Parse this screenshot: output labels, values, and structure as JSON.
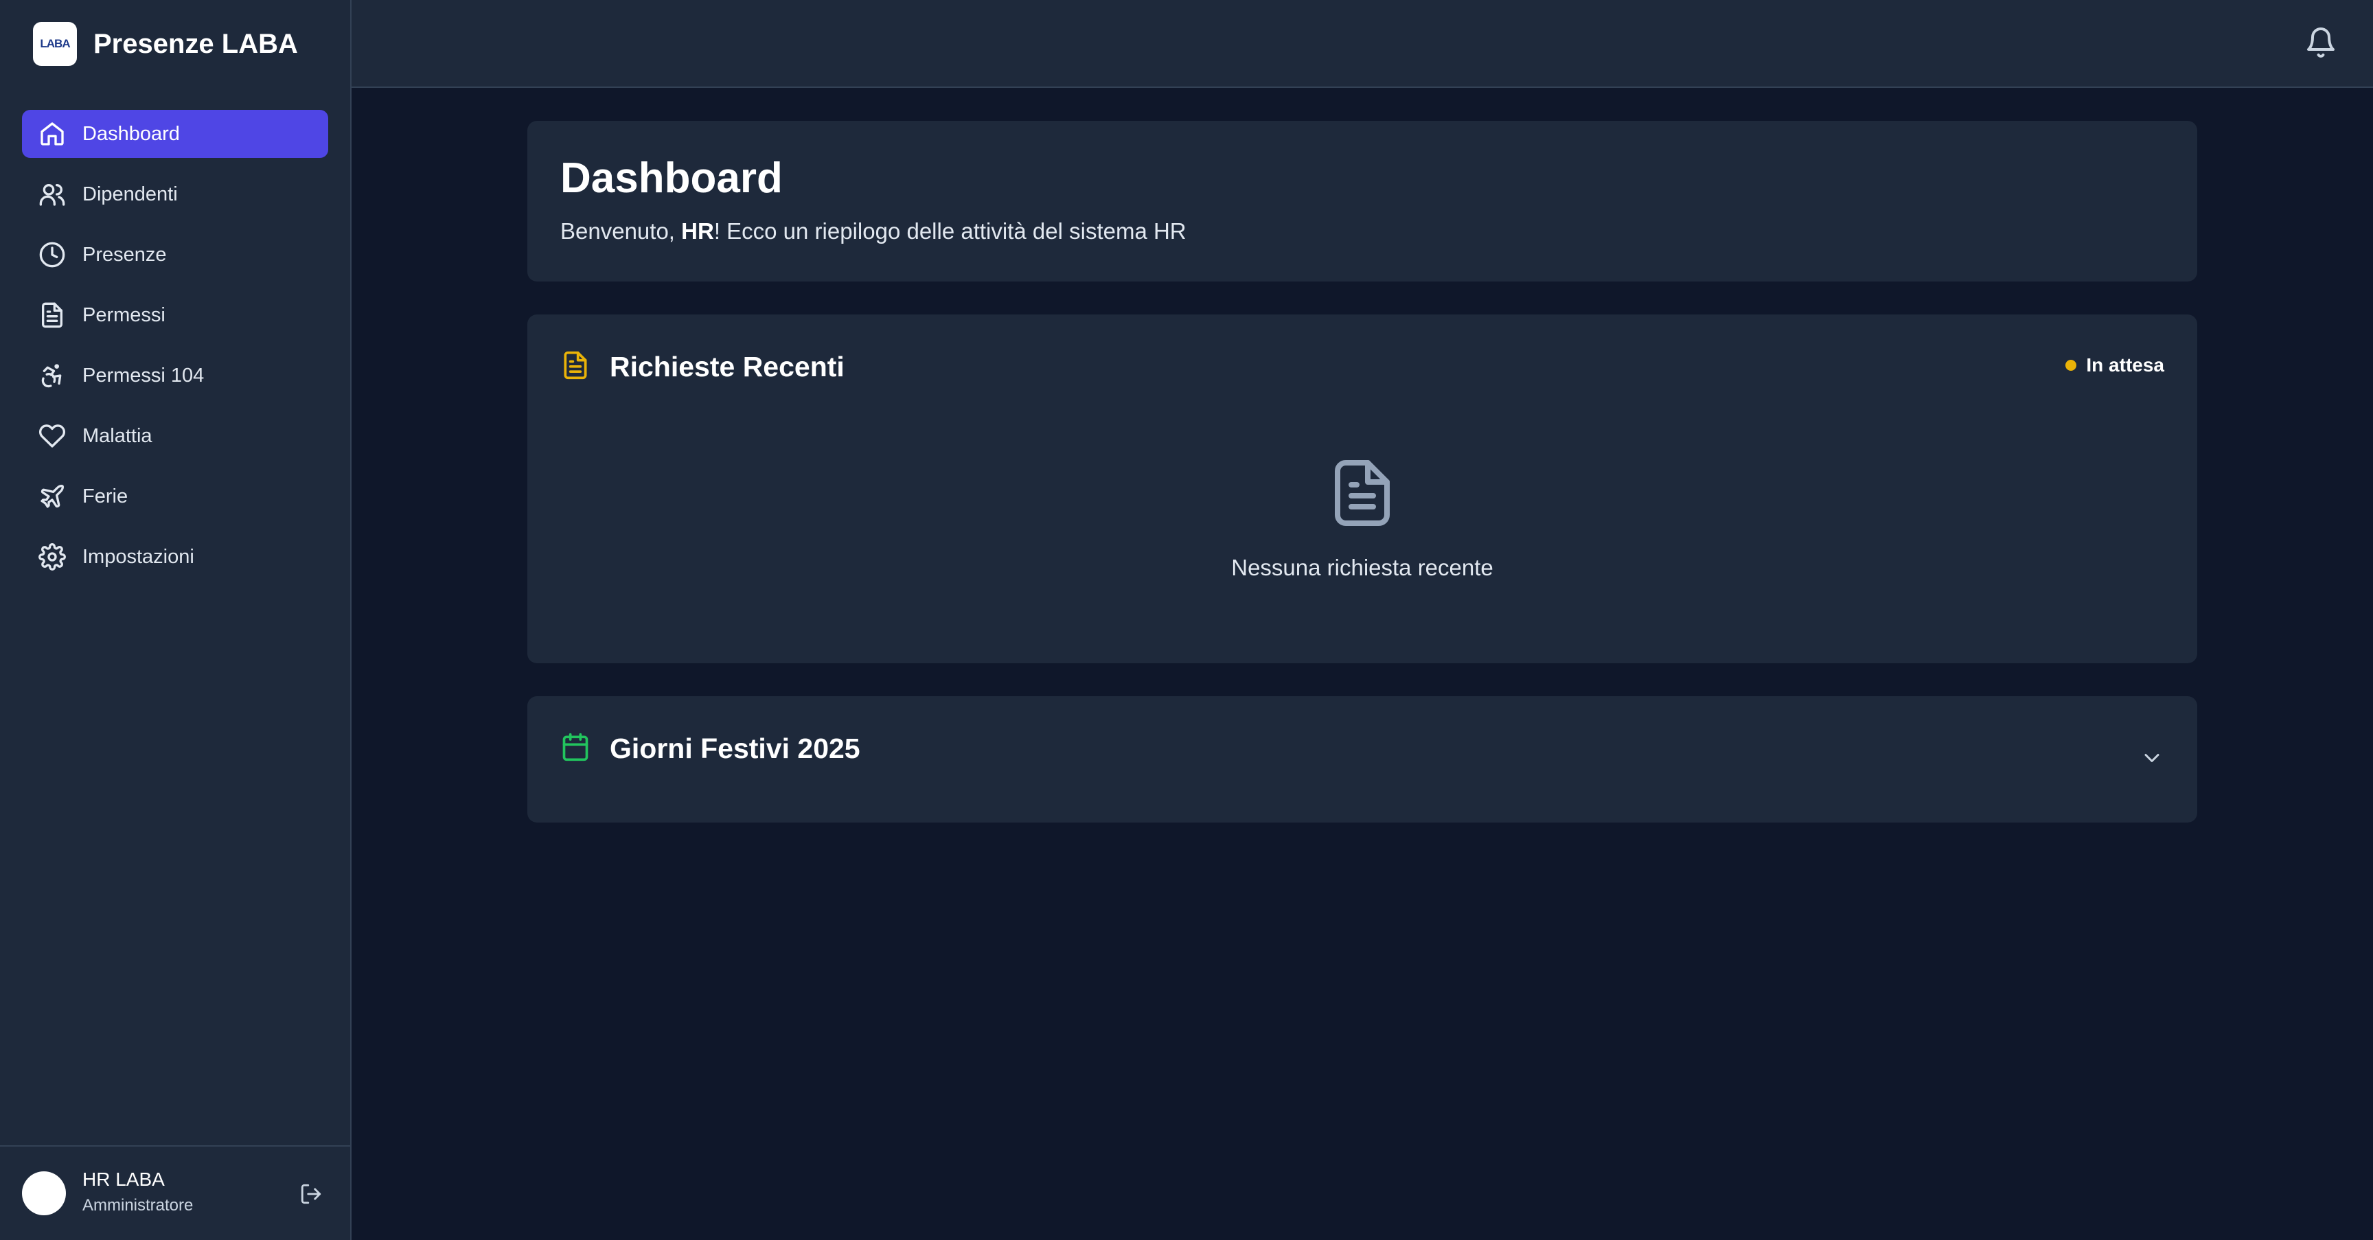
{
  "app": {
    "title": "Presenze LABA",
    "logo_text": "LABA"
  },
  "sidebar": {
    "items": [
      {
        "label": "Dashboard",
        "icon": "home-icon",
        "active": true
      },
      {
        "label": "Dipendenti",
        "icon": "users-icon"
      },
      {
        "label": "Presenze",
        "icon": "clock-icon"
      },
      {
        "label": "Permessi",
        "icon": "file-text-icon"
      },
      {
        "label": "Permessi 104",
        "icon": "accessibility-icon"
      },
      {
        "label": "Malattia",
        "icon": "heart-icon"
      },
      {
        "label": "Ferie",
        "icon": "plane-icon"
      },
      {
        "label": "Impostazioni",
        "icon": "gear-icon"
      }
    ],
    "user": {
      "name": "HR LABA",
      "role": "Amministratore"
    }
  },
  "topbar": {
    "icon": "bell-icon"
  },
  "main": {
    "title": "Dashboard",
    "welcome": {
      "prefix": "Benvenuto, ",
      "name": "HR",
      "suffix": "! Ecco un riepilogo delle attività del sistema HR"
    },
    "requests": {
      "title": "Richieste Recenti",
      "status": "In attesa",
      "empty_text": "Nessuna richiesta recente"
    },
    "holidays": {
      "title": "Giorni Festivi 2025"
    }
  },
  "colors": {
    "accent": "#4f46e5",
    "sidebar_bg": "#1e293b",
    "page_bg": "#0f172a",
    "pending": "#eab308",
    "requests_icon": "#eab308",
    "holidays_icon": "#22c55e"
  }
}
